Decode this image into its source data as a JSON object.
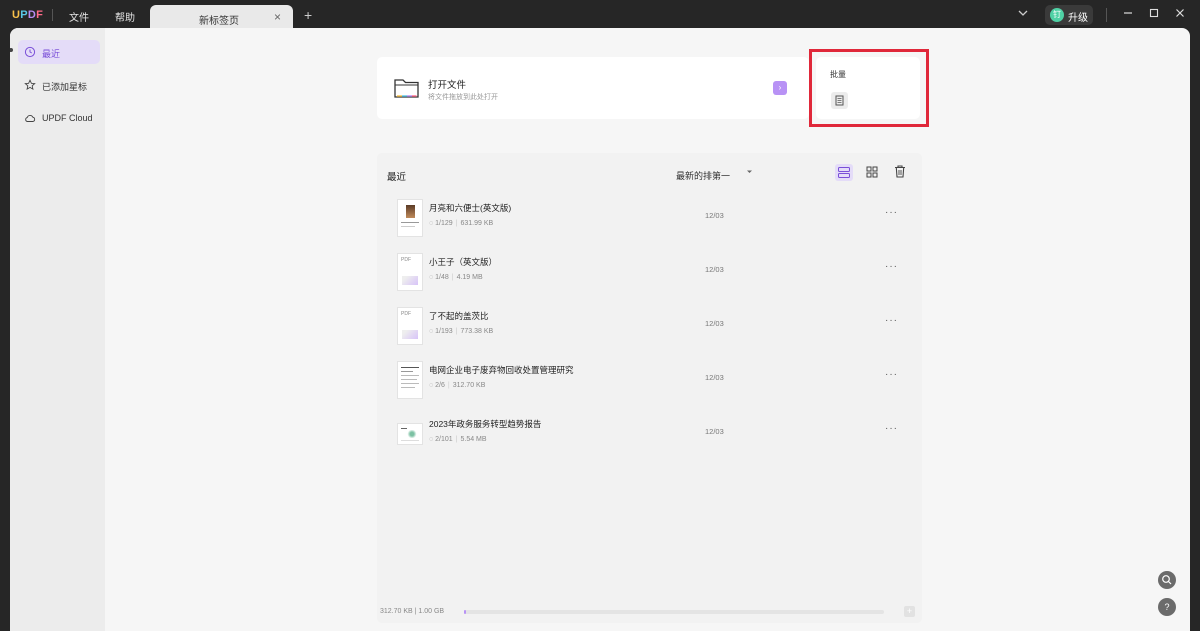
{
  "titlebar": {
    "logo": "UPDF",
    "menus": [
      "文件",
      "帮助"
    ],
    "tab_label": "新标签页",
    "tab_close": "×",
    "tab_add": "+",
    "upgrade_badge": "钉",
    "upgrade_label": "升级"
  },
  "sidebar": {
    "items": [
      {
        "label": "最近"
      },
      {
        "label": "已添加星标"
      },
      {
        "label": "UPDF Cloud"
      }
    ]
  },
  "open_card": {
    "title": "打开文件",
    "subtitle": "将文件拖放到此处打开",
    "arrow": "›"
  },
  "batch_card": {
    "title": "批量"
  },
  "recent": {
    "title": "最近",
    "sort_label": "最新的排第一",
    "files": [
      {
        "name": "月亮和六便士(英文版)",
        "pages": "1/129",
        "size": "631.99 KB",
        "date": "12/03"
      },
      {
        "name": "小王子（英文版）",
        "pages": "1/48",
        "size": "4.19 MB",
        "date": "12/03"
      },
      {
        "name": "了不起的盖茨比",
        "pages": "1/193",
        "size": "773.38 KB",
        "date": "12/03"
      },
      {
        "name": "电网企业电子废弃物回收处置管理研究",
        "pages": "2/6",
        "size": "312.70 KB",
        "date": "12/03"
      },
      {
        "name": "2023年政务服务转型趋势报告",
        "pages": "2/101",
        "size": "5.54 MB",
        "date": "12/03"
      }
    ],
    "more": "···",
    "thumb_pdf_label": "PDF"
  },
  "storage": {
    "text": "312.70 KB | 1.00 GB",
    "used_fraction": 0.0003
  },
  "float_buttons": {
    "help": "?"
  },
  "colors": {
    "accent": "#b892f5",
    "highlight": "#e0283a"
  }
}
